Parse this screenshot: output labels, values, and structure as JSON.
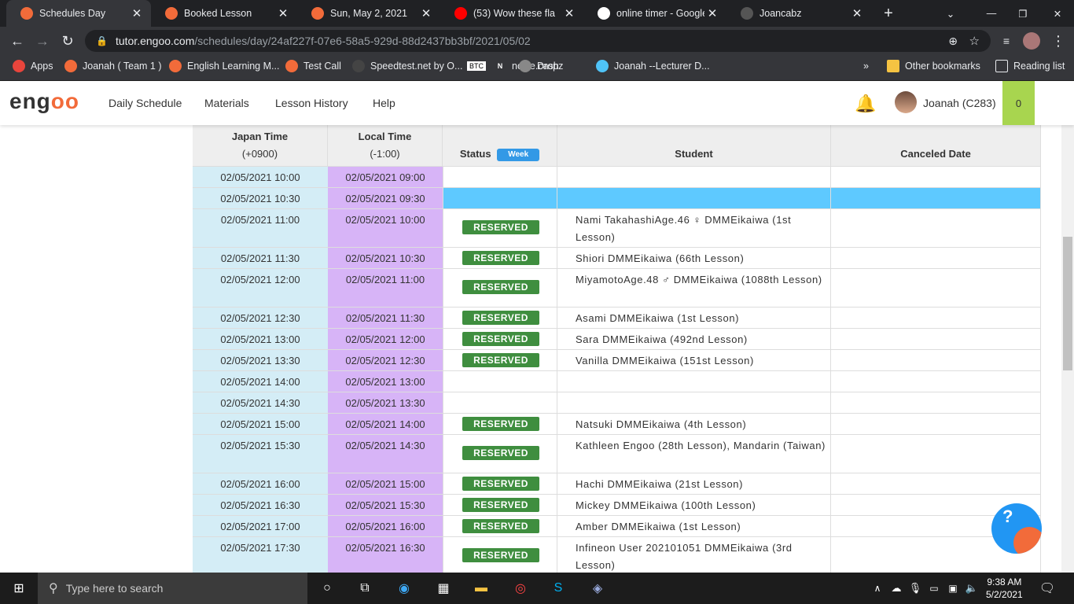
{
  "browser": {
    "tabs": [
      {
        "title": "Schedules Day",
        "icon": "engoo-favicon",
        "active": true
      },
      {
        "title": "Booked Lesson",
        "icon": "engoo-favicon",
        "active": false
      },
      {
        "title": "Sun, May 2, 2021",
        "icon": "engoo-favicon",
        "active": false
      },
      {
        "title": "(53) Wow these fla",
        "icon": "youtube-favicon",
        "active": false
      },
      {
        "title": "online timer - Google",
        "icon": "google-favicon",
        "active": false
      },
      {
        "title": "Joancabz",
        "icon": "noise-favicon",
        "active": false
      }
    ],
    "url_host": "tutor.engoo.com",
    "url_path": "/schedules/day/24af227f-07e6-58a5-929d-88d2437bb3bf/2021/05/02",
    "bookmarks": [
      "Apps",
      "Joanah ( Team 1 )",
      "English Learning M...",
      "Test Call",
      "Speedtest.net by O...",
      "BTC",
      "noise.cash",
      "Dropz",
      "Joanah --Lecturer D..."
    ],
    "other_bookmarks": "Other bookmarks",
    "reading_list": "Reading list"
  },
  "site": {
    "logo": "engoo",
    "nav": [
      "Daily Schedule",
      "Materials",
      "Lesson History",
      "Help"
    ],
    "user_name": "Joanah (C283)",
    "points": "0"
  },
  "table": {
    "headers": {
      "japan_time": "Japan Time",
      "japan_offset": "(+0900)",
      "local_time": "Local Time",
      "local_offset": "(-1:00)",
      "status": "Status",
      "week_button": "Week",
      "student": "Student",
      "canceled_date": "Canceled Date"
    },
    "rows": [
      {
        "japan": "02/05/2021 10:00",
        "local": "02/05/2021 09:00",
        "status": "",
        "student": "",
        "tall": false,
        "highlight": false
      },
      {
        "japan": "02/05/2021 10:30",
        "local": "02/05/2021 09:30",
        "status": "",
        "student": "",
        "tall": false,
        "highlight": true
      },
      {
        "japan": "02/05/2021 11:00",
        "local": "02/05/2021 10:00",
        "status": "RESERVED",
        "student": "Nami TakahashiAge.46 ♀ DMMEikaiwa (1st Lesson)",
        "tall": true,
        "highlight": false
      },
      {
        "japan": "02/05/2021 11:30",
        "local": "02/05/2021 10:30",
        "status": "RESERVED",
        "student": "Shiori DMMEikaiwa (66th Lesson)",
        "tall": false,
        "highlight": false
      },
      {
        "japan": "02/05/2021 12:00",
        "local": "02/05/2021 11:00",
        "status": "RESERVED",
        "student": "MiyamotoAge.48 ♂ DMMEikaiwa (1088th Lesson)",
        "tall": true,
        "highlight": false
      },
      {
        "japan": "02/05/2021 12:30",
        "local": "02/05/2021 11:30",
        "status": "RESERVED",
        "student": "Asami DMMEikaiwa (1st Lesson)",
        "tall": false,
        "highlight": false
      },
      {
        "japan": "02/05/2021 13:00",
        "local": "02/05/2021 12:00",
        "status": "RESERVED",
        "student": "Sara DMMEikaiwa (492nd Lesson)",
        "tall": false,
        "highlight": false
      },
      {
        "japan": "02/05/2021 13:30",
        "local": "02/05/2021 12:30",
        "status": "RESERVED",
        "student": "Vanilla DMMEikaiwa (151st Lesson)",
        "tall": false,
        "highlight": false
      },
      {
        "japan": "02/05/2021 14:00",
        "local": "02/05/2021 13:00",
        "status": "",
        "student": "",
        "tall": false,
        "highlight": false
      },
      {
        "japan": "02/05/2021 14:30",
        "local": "02/05/2021 13:30",
        "status": "",
        "student": "",
        "tall": false,
        "highlight": false
      },
      {
        "japan": "02/05/2021 15:00",
        "local": "02/05/2021 14:00",
        "status": "RESERVED",
        "student": "Natsuki DMMEikaiwa (4th Lesson)",
        "tall": false,
        "highlight": false
      },
      {
        "japan": "02/05/2021 15:30",
        "local": "02/05/2021 14:30",
        "status": "RESERVED",
        "student": "Kathleen Engoo (28th Lesson), Mandarin (Taiwan)",
        "tall": true,
        "highlight": false
      },
      {
        "japan": "02/05/2021 16:00",
        "local": "02/05/2021 15:00",
        "status": "RESERVED",
        "student": "Hachi DMMEikaiwa (21st Lesson)",
        "tall": false,
        "highlight": false
      },
      {
        "japan": "02/05/2021 16:30",
        "local": "02/05/2021 15:30",
        "status": "RESERVED",
        "student": "Mickey DMMEikaiwa (100th Lesson)",
        "tall": false,
        "highlight": false
      },
      {
        "japan": "02/05/2021 17:00",
        "local": "02/05/2021 16:00",
        "status": "RESERVED",
        "student": "Amber DMMEikaiwa (1st Lesson)",
        "tall": false,
        "highlight": false
      },
      {
        "japan": "02/05/2021 17:30",
        "local": "02/05/2021 16:30",
        "status": "RESERVED",
        "student": "Infineon User 202101051 DMMEikaiwa (3rd Lesson)",
        "tall": true,
        "highlight": false
      }
    ]
  },
  "taskbar": {
    "search_placeholder": "Type here to search",
    "time": "9:38 AM",
    "date": "5/2/2021"
  }
}
